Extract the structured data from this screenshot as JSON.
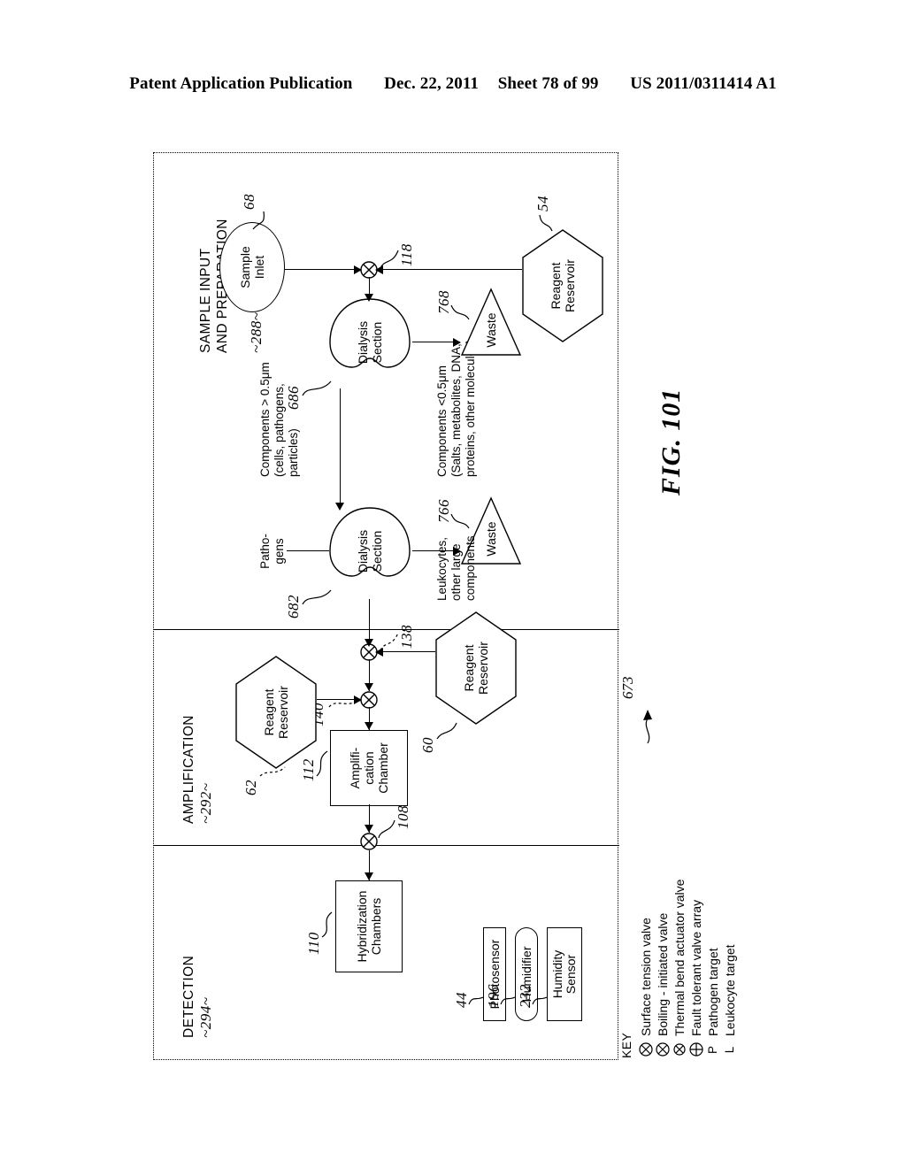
{
  "header": {
    "publication": "Patent Application Publication",
    "date": "Dec. 22, 2011",
    "sheet": "Sheet 78 of 99",
    "number": "US 2011/0311414 A1"
  },
  "figure": {
    "label": "FIG. 101",
    "assembly_ref": "673"
  },
  "sections": [
    {
      "id": "detection",
      "title": "DETECTION",
      "ref": "~294~"
    },
    {
      "id": "amplification",
      "title": "AMPLIFICATION",
      "ref": "~292~"
    },
    {
      "id": "sample",
      "title": "SAMPLE INPUT\nAND PREPARATION",
      "ref": "~288~"
    }
  ],
  "nodes": {
    "hybridization_chambers": {
      "label": "Hybridization\nChambers",
      "ref": "110"
    },
    "amplification_chamber": {
      "label": "Amplifi-\ncation\nChamber",
      "ref": "112"
    },
    "photosensor": {
      "label": "Photosensor",
      "ref": "44"
    },
    "humidifier": {
      "label": "Humidifier",
      "ref": "196"
    },
    "humidity_sensor": {
      "label": "Humidity\nSensor",
      "ref": "232"
    },
    "reagent_reservoir_60": {
      "label": "Reagent\nReservoir",
      "ref": "60"
    },
    "reagent_reservoir_62": {
      "label": "Reagent\nReservoir",
      "ref": "62"
    },
    "reagent_reservoir_54": {
      "label": "Reagent\nReservoir",
      "ref": "54"
    },
    "sample_inlet": {
      "label": "Sample\nInlet",
      "ref": "68"
    },
    "dialysis_section_682": {
      "label": "Dialysis\nSection",
      "ref": "682"
    },
    "dialysis_section_686": {
      "label": "Dialysis\nSection",
      "ref": "686"
    },
    "waste_766": {
      "label": "Waste",
      "ref": "766"
    },
    "waste_768": {
      "label": "Waste",
      "ref": "768"
    }
  },
  "valves": [
    {
      "id": "valve-108",
      "ref": "108"
    },
    {
      "id": "valve-140",
      "ref": "140"
    },
    {
      "id": "valve-138",
      "ref": "138"
    },
    {
      "id": "valve-118",
      "ref": "118"
    }
  ],
  "flow_labels": {
    "pathogens": "Patho-\ngens",
    "leukocytes": "Leukocytes,\nother large\ncomponents",
    "components_large": "Components > 0.5μm\n(cells, pathogens,\nparticles)",
    "components_small": "Components <0.5μm\n(Salts, metabolites, DNA,\nproteins, other molecules)"
  },
  "key": {
    "title": "KEY",
    "items": [
      {
        "symbol": "circle-x",
        "label": "Surface tension valve"
      },
      {
        "symbol": "circle-x",
        "label": "Boiling - initiated valve"
      },
      {
        "symbol": "circle-x-small",
        "label": "Thermal bend actuator valve"
      },
      {
        "symbol": "circle-plus",
        "label": "Fault tolerant valve array"
      },
      {
        "symbol": "P",
        "label": "Pathogen target"
      },
      {
        "symbol": "L",
        "label": "Leukocyte target"
      }
    ]
  }
}
